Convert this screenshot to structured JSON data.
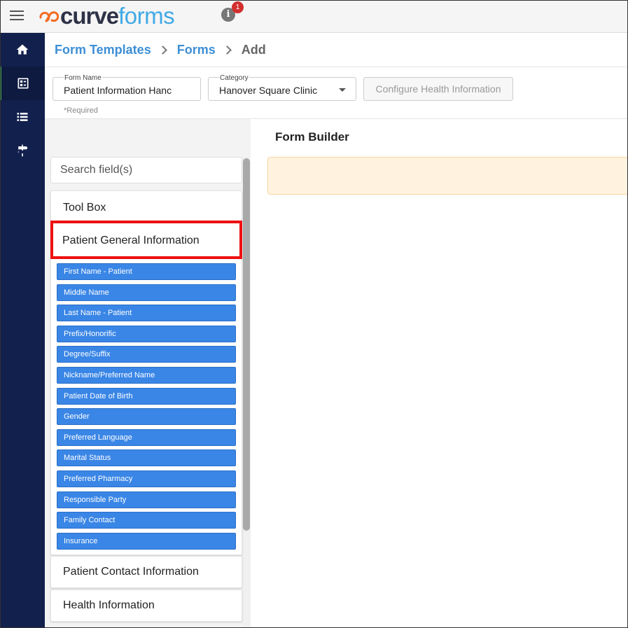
{
  "app": {
    "logo_curve": "curve",
    "logo_forms": "forms",
    "info_icon_glyph": "i",
    "notification_count": "1"
  },
  "sidebar": {
    "items": [
      {
        "icon": "home-icon"
      },
      {
        "icon": "forms-icon"
      },
      {
        "icon": "list-icon"
      },
      {
        "icon": "signpost-icon"
      }
    ]
  },
  "breadcrumb": {
    "items": [
      "Form Templates",
      "Forms"
    ],
    "current": "Add"
  },
  "form": {
    "name_label": "Form Name",
    "name_value": "Patient Information Hanc",
    "category_label": "Category",
    "category_value": "Hanover Square Clinic",
    "configure_button": "Configure Health Information",
    "required_note": "*Required"
  },
  "builder": {
    "title": "Form Builder",
    "search_placeholder": "Search field(s)"
  },
  "toolbox": {
    "title": "Tool Box",
    "sections": [
      {
        "title": "Patient General Information",
        "fields": [
          "First Name - Patient",
          "Middle Name",
          "Last Name - Patient",
          "Prefix/Honorific",
          "Degree/Suffix",
          "Nickname/Preferred Name",
          "Patient Date of Birth",
          "Gender",
          "Preferred Language",
          "Marital Status",
          "Preferred Pharmacy",
          "Responsible Party",
          "Family Contact",
          "Insurance"
        ]
      },
      {
        "title": "Patient Contact Information"
      },
      {
        "title": "Health Information"
      }
    ]
  },
  "colors": {
    "sidebar_bg": "#12204d",
    "chip_blue": "#3a86e6",
    "link_blue": "#3d8fd6",
    "highlight_red": "#ee1111",
    "drop_zone_bg": "#fff3e0"
  }
}
